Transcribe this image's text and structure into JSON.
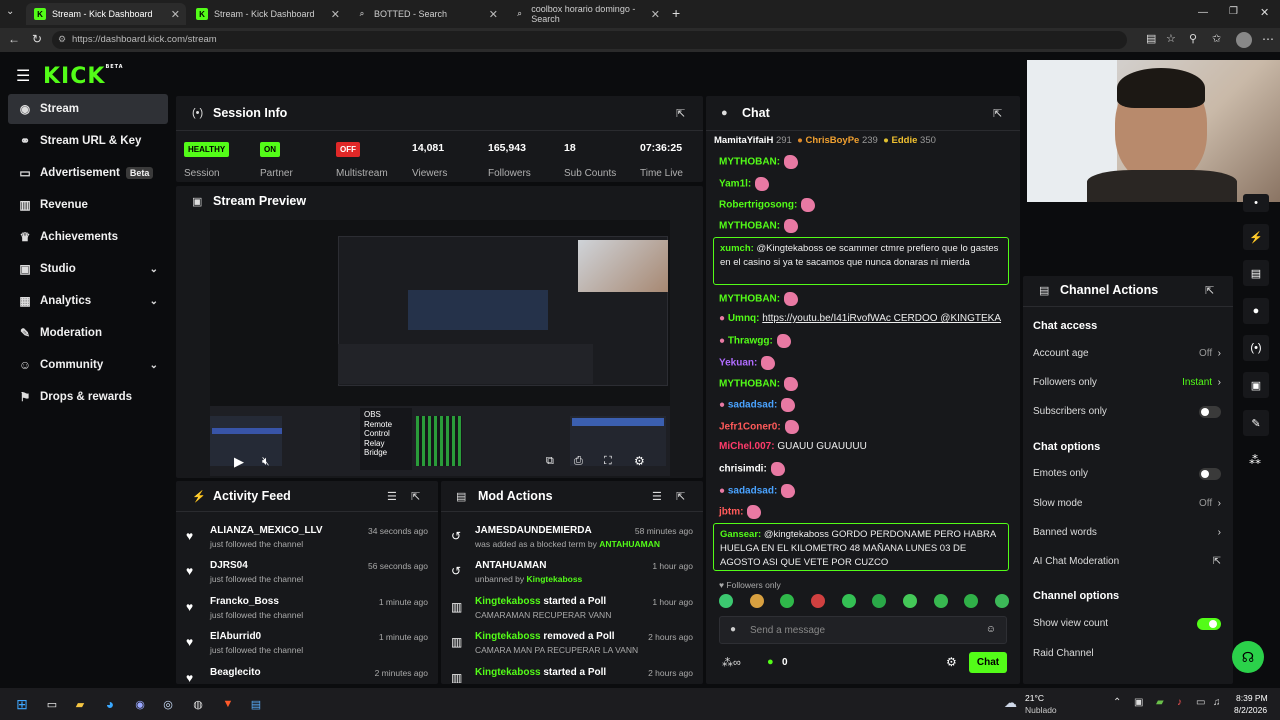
{
  "browser": {
    "tabs": [
      {
        "label": "Stream - Kick Dashboard"
      },
      {
        "label": "Stream - Kick Dashboard"
      },
      {
        "label": "BOTTED - Search"
      },
      {
        "label": "coolbox horario domingo - Search"
      }
    ],
    "url": "https://dashboard.kick.com/stream"
  },
  "logo": "KICK",
  "logo_sup": "BETA",
  "sidebar": {
    "items": [
      {
        "label": "Stream"
      },
      {
        "label": "Stream URL & Key"
      },
      {
        "label": "Advertisement",
        "badge": "Beta"
      },
      {
        "label": "Revenue"
      },
      {
        "label": "Achievements"
      },
      {
        "label": "Studio"
      },
      {
        "label": "Analytics"
      },
      {
        "label": "Moderation"
      },
      {
        "label": "Community"
      },
      {
        "label": "Drops & rewards"
      }
    ]
  },
  "session": {
    "title": "Session Info",
    "stats": [
      {
        "badge": "HEALTHY",
        "label": "Session"
      },
      {
        "badge": "ON",
        "label": "Partner"
      },
      {
        "badge": "OFF",
        "label": "Multistream"
      },
      {
        "value": "14,081",
        "label": "Viewers"
      },
      {
        "value": "165,943",
        "label": "Followers"
      },
      {
        "value": "18",
        "label": "Sub Counts"
      },
      {
        "value": "07:36:25",
        "label": "Time Live"
      }
    ]
  },
  "preview": {
    "title": "Stream Preview",
    "obs_text": [
      "OBS",
      "Remote",
      "Control",
      "Relay",
      "Bridge"
    ]
  },
  "activity": {
    "title": "Activity Feed",
    "rows": [
      {
        "name": "ALIANZA_MEXICO_LLV",
        "sub": "just followed the channel",
        "time": "34 seconds ago"
      },
      {
        "name": "DJRS04",
        "sub": "just followed the channel",
        "time": "56 seconds ago"
      },
      {
        "name": "Francko_Boss",
        "sub": "just followed the channel",
        "time": "1 minute ago"
      },
      {
        "name": "ElAburrid0",
        "sub": "just followed the channel",
        "time": "1 minute ago"
      },
      {
        "name": "Beaglecito",
        "sub": "",
        "time": "2 minutes ago"
      }
    ]
  },
  "mod": {
    "title": "Mod Actions",
    "rows": [
      {
        "name": "JAMESDAUNDEMIERDA",
        "sub": "was added as a blocked term by",
        "by": "ANTAHUAMAN",
        "time": "58 minutes ago"
      },
      {
        "name": "ANTAHUAMAN",
        "sub": "unbanned by",
        "by": "Kingtekaboss",
        "time": "1 hour ago"
      },
      {
        "name": "Kingtekaboss",
        "action": "started a Poll",
        "sub": "CAMARAMAN RECUPERAR VANN",
        "time": "1 hour ago"
      },
      {
        "name": "Kingtekaboss",
        "action": "removed a Poll",
        "sub": "CAMARA MAN PA RECUPERAR LA VANN",
        "time": "2 hours ago"
      },
      {
        "name": "Kingtekaboss",
        "action": "started a Poll",
        "sub": "",
        "time": "2 hours ago"
      }
    ]
  },
  "chat": {
    "title": "Chat",
    "top_gifters": [
      {
        "name": "MamitaYifaiH",
        "count": "291"
      },
      {
        "name": "ChrisBoyPe",
        "count": "239"
      },
      {
        "name": "Eddie",
        "count": "350"
      }
    ],
    "messages": [
      {
        "user": "MYTHOBAN:",
        "text": "",
        "color": "#53fc18"
      },
      {
        "user": "Yam1l:",
        "text": "",
        "color": "#53fc18"
      },
      {
        "user": "Robertrigosong:",
        "text": "",
        "color": "#53fc18"
      },
      {
        "user": "MYTHOBAN:",
        "text": "",
        "color": "#53fc18"
      },
      {
        "user": "MYTHOBAN:",
        "text": "",
        "color": "#53fc18"
      },
      {
        "user": "Umnq:",
        "text": "https://youtu.be/I41iRvofWAc CERDOO @KINGTEKA",
        "color": "#53fc18"
      },
      {
        "user": "Thrawgg:",
        "text": "",
        "color": "#53fc18"
      },
      {
        "user": "Yekuan:",
        "text": "",
        "color": "#b06cff"
      },
      {
        "user": "MYTHOBAN:",
        "text": "",
        "color": "#53fc18"
      },
      {
        "user": "sadadsad:",
        "text": "",
        "color": "#4aa3ff"
      },
      {
        "user": "Jefr1Coner0:",
        "text": "",
        "color": "#ff5a5a"
      },
      {
        "user": "MiChel.007:",
        "text": "GUAUU GUAUUUU",
        "color": "#ff3b6b"
      },
      {
        "user": "chrisimdi:",
        "text": "",
        "color": "#ffffff"
      },
      {
        "user": "sadadsad:",
        "text": "",
        "color": "#4aa3ff"
      },
      {
        "user": "jbtm:",
        "text": "",
        "color": "#ff5a5a"
      }
    ],
    "highlight1": {
      "user": "xumch:",
      "text": "@Kingtekaboss oe scammer ctmre prefiero que lo gastes en el casino si ya te sacamos que nunca donaras ni mierda"
    },
    "highlight2": {
      "user": "Gansear:",
      "text": "@kingtekaboss GORDO PERDONAME PERO HABRA HUELGA EN EL KILOMETRO 48 MAÑANA LUNES 03 DE AGOSTO ASI QUE VETE POR CUZCO"
    },
    "followers_only": "Followers only",
    "placeholder": "Send a message",
    "count": "0",
    "send_label": "Chat"
  },
  "channel_actions": {
    "title": "Channel Actions",
    "chat_access": "Chat access",
    "account_age": "Account age",
    "account_age_val": "Off",
    "followers_only": "Followers only",
    "followers_only_val": "Instant",
    "subscribers_only": "Subscribers only",
    "chat_options": "Chat options",
    "emotes_only": "Emotes only",
    "slow_mode": "Slow mode",
    "slow_mode_val": "Off",
    "banned_words": "Banned words",
    "ai_mod": "AI Chat Moderation",
    "channel_options": "Channel options",
    "show_view_count": "Show view count",
    "raid_channel": "Raid Channel"
  },
  "taskbar": {
    "weather_temp": "21°C",
    "weather_desc": "Nublado",
    "time": "8:39 PM",
    "date": "8/2/2026"
  },
  "colors": {
    "accent": "#53fc18",
    "panel": "#17181b",
    "bg": "#0b0c0e"
  }
}
